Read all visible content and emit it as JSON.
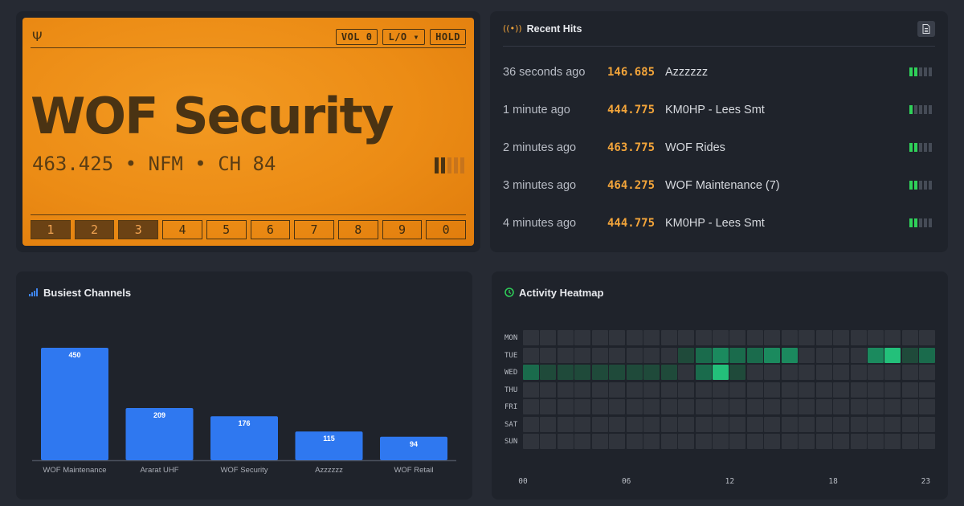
{
  "scanner": {
    "channel_name": "WOF Security",
    "frequency_line": "463.425 • NFM • CH 84",
    "signal_level": 2,
    "signal_max": 5,
    "buttons": [
      {
        "label": "VOL 0"
      },
      {
        "label": "L/O ▾"
      },
      {
        "label": "HOLD"
      }
    ],
    "banks": [
      {
        "label": "1",
        "active": true
      },
      {
        "label": "2",
        "active": true
      },
      {
        "label": "3",
        "active": true
      },
      {
        "label": "4",
        "active": false
      },
      {
        "label": "5",
        "active": false
      },
      {
        "label": "6",
        "active": false
      },
      {
        "label": "7",
        "active": false
      },
      {
        "label": "8",
        "active": false
      },
      {
        "label": "9",
        "active": false
      },
      {
        "label": "0",
        "active": false
      }
    ],
    "colors": {
      "lcd": "#ec8c15",
      "ink": "#4a3313"
    }
  },
  "recent_hits": {
    "title": "Recent Hits",
    "hits": [
      {
        "time": "36 seconds ago",
        "freq": "146.685",
        "name": "Azzzzzz",
        "signal": 2
      },
      {
        "time": "1 minute ago",
        "freq": "444.775",
        "name": "KM0HP - Lees Smt",
        "signal": 1
      },
      {
        "time": "2 minutes ago",
        "freq": "463.775",
        "name": "WOF Rides",
        "signal": 2
      },
      {
        "time": "3 minutes ago",
        "freq": "464.275",
        "name": "WOF Maintenance (7)",
        "signal": 2
      },
      {
        "time": "4 minutes ago",
        "freq": "444.775",
        "name": "KM0HP - Lees Smt",
        "signal": 2
      }
    ],
    "signal_max": 5,
    "colors": {
      "freq": "#f2a43a",
      "signal_on": "#2fd159",
      "signal_off": "#454b56"
    }
  },
  "busiest": {
    "title": "Busiest Channels",
    "chart_data": {
      "type": "bar",
      "categories": [
        "WOF Maintenance",
        "Ararat UHF",
        "WOF Security",
        "Azzzzzz",
        "WOF Retail"
      ],
      "values": [
        450,
        209,
        176,
        115,
        94
      ],
      "value_labels": [
        "450",
        "209",
        "176",
        "115",
        "94"
      ],
      "ylim": [
        0,
        450
      ],
      "grid": false,
      "color": "#2f78f0"
    }
  },
  "heatmap": {
    "title": "Activity Heatmap",
    "days": [
      "MON",
      "TUE",
      "WED",
      "THU",
      "FRI",
      "SAT",
      "SUN"
    ],
    "hour_ticks": [
      {
        "hour": 0,
        "label": "00"
      },
      {
        "hour": 6,
        "label": "06"
      },
      {
        "hour": 12,
        "label": "12"
      },
      {
        "hour": 18,
        "label": "18"
      },
      {
        "hour": 23,
        "label": "23"
      }
    ],
    "levels": [
      [
        0,
        0,
        0,
        0,
        0,
        0,
        0,
        0,
        0,
        0,
        0,
        0,
        0,
        0,
        0,
        0,
        0,
        0,
        0,
        0,
        0,
        0,
        0,
        0
      ],
      [
        0,
        0,
        0,
        0,
        0,
        0,
        0,
        0,
        0,
        1,
        2,
        3,
        2,
        2,
        3,
        3,
        0,
        0,
        0,
        0,
        3,
        4,
        1,
        2
      ],
      [
        2,
        1,
        1,
        1,
        1,
        1,
        1,
        1,
        1,
        0,
        2,
        4,
        1,
        0,
        0,
        0,
        0,
        0,
        0,
        0,
        0,
        0,
        0,
        0
      ],
      [
        0,
        0,
        0,
        0,
        0,
        0,
        0,
        0,
        0,
        0,
        0,
        0,
        0,
        0,
        0,
        0,
        0,
        0,
        0,
        0,
        0,
        0,
        0,
        0
      ],
      [
        0,
        0,
        0,
        0,
        0,
        0,
        0,
        0,
        0,
        0,
        0,
        0,
        0,
        0,
        0,
        0,
        0,
        0,
        0,
        0,
        0,
        0,
        0,
        0
      ],
      [
        0,
        0,
        0,
        0,
        0,
        0,
        0,
        0,
        0,
        0,
        0,
        0,
        0,
        0,
        0,
        0,
        0,
        0,
        0,
        0,
        0,
        0,
        0,
        0
      ],
      [
        0,
        0,
        0,
        0,
        0,
        0,
        0,
        0,
        0,
        0,
        0,
        0,
        0,
        0,
        0,
        0,
        0,
        0,
        0,
        0,
        0,
        0,
        0,
        0
      ]
    ],
    "palette": [
      "#30343c",
      "#1f4a3a",
      "#1a6b4c",
      "#1b8a5e",
      "#23c07a"
    ]
  }
}
